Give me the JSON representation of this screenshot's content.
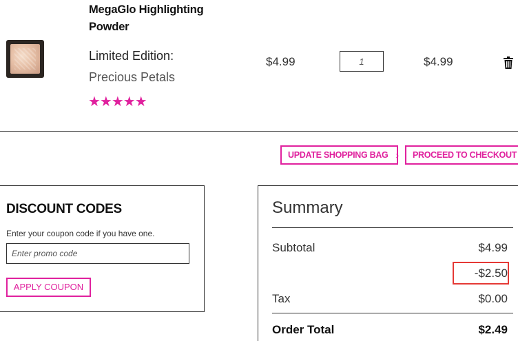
{
  "product": {
    "name": "MegaGlo Highlighting Powder",
    "variant_label": "Limited Edition:",
    "variant_value": "Precious Petals",
    "rating_stars": "★★★★★",
    "rating": 4.5,
    "price": "$4.99",
    "quantity": "1",
    "line_total": "$4.99",
    "thumbnail": "highlighter-compact-image",
    "delete_icon": "trash-icon"
  },
  "actions": {
    "update_label": "UPDATE SHOPPING BAG",
    "checkout_label": "PROCEED TO CHECKOUT",
    "chevron": "›"
  },
  "discount": {
    "title": "DISCOUNT CODES",
    "help_text": "Enter your coupon code if you have one.",
    "placeholder": "Enter promo code",
    "apply_label": "APPLY COUPON"
  },
  "summary": {
    "title": "Summary",
    "subtotal_label": "Subtotal",
    "subtotal_value": "$4.99",
    "discount_value": "-$2.50",
    "tax_label": "Tax",
    "tax_value": "$0.00",
    "total_label": "Order Total",
    "total_value": "$2.49"
  },
  "colors": {
    "accent": "#e0219e",
    "highlight": "#e53935"
  }
}
